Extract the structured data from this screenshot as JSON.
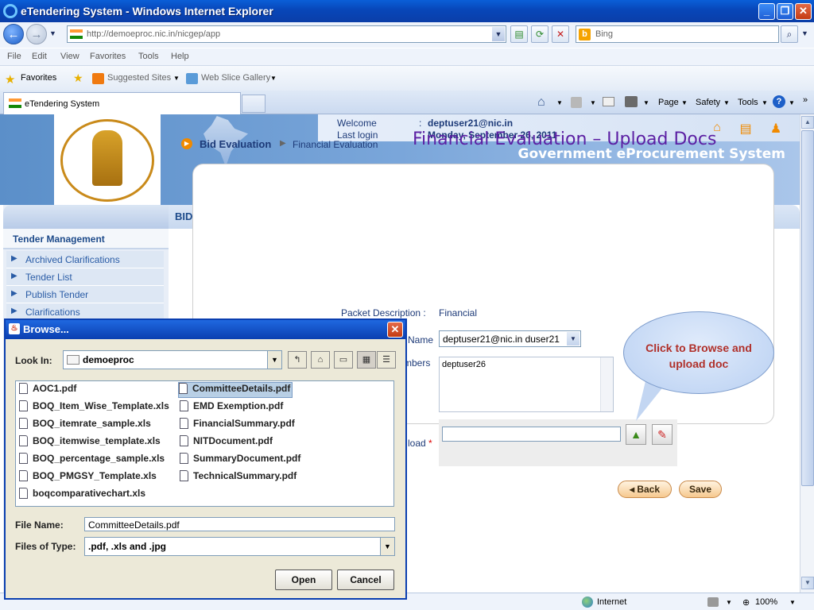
{
  "window": {
    "title": "eTendering System - Windows Internet Explorer",
    "address": "http://demoeproc.nic.in/nicgep/app",
    "search_placeholder": "Bing"
  },
  "menu": [
    "File",
    "Edit",
    "View",
    "Favorites",
    "Tools",
    "Help"
  ],
  "favorites": {
    "label": "Favorites",
    "suggested": "Suggested Sites",
    "webslice": "Web Slice Gallery"
  },
  "tab": {
    "title": "eTendering System"
  },
  "commandbar": {
    "page": "Page",
    "safety": "Safety",
    "tools": "Tools"
  },
  "header": {
    "welcome_label": "Welcome",
    "welcome_value": "deptuser21@nic.in",
    "lastlogin_label": "Last login",
    "lastlogin_value": "Monday, September 26, 2011",
    "separator": ":",
    "system_title": "Government eProcurement System",
    "emblem_text": "Government eProcurement System"
  },
  "sidebar": {
    "heading": "Tender Management",
    "items": [
      {
        "label": "Archived Clarifications"
      },
      {
        "label": "Tender List"
      },
      {
        "label": "Publish Tender"
      },
      {
        "label": "Clarifications"
      }
    ]
  },
  "main": {
    "section_title": "BID EVALUATION",
    "breadcrumb_1": "Bid Evaluation",
    "breadcrumb_2": "Financial Evaluation",
    "page_title": "Financial Evaluation – Upload Docs",
    "packet_label": "Packet Description :",
    "packet_value": "Financial",
    "name_label_fragment": "Name",
    "name_select": "deptuser21@nic.in duser21",
    "members_label_fragment": "mbers",
    "members_value": "deptuser26",
    "upload_label_fragment": "load",
    "back_label": "Back",
    "save_label": "Save",
    "callout": "Click to Browse and upload doc"
  },
  "statusbar": {
    "zone": "Internet",
    "zoom": "100%"
  },
  "dialog": {
    "title": "Browse...",
    "look_in_label": "Look In:",
    "look_in_value": "demoeproc",
    "files_col1": [
      "AOC1.pdf",
      "BOQ_Item_Wise_Template.xls",
      "BOQ_itemrate_sample.xls",
      "BOQ_itemwise_template.xls",
      "BOQ_percentage_sample.xls",
      "BOQ_PMGSY_Template.xls",
      "boqcomparativechart.xls"
    ],
    "files_col2": [
      "CommitteeDetails.pdf",
      "EMD Exemption.pdf",
      "FinancialSummary.pdf",
      "NITDocument.pdf",
      "SummaryDocument.pdf",
      "TechnicalSummary.pdf"
    ],
    "selected_file": "CommitteeDetails.pdf",
    "file_name_label": "File Name:",
    "file_name_value": "CommitteeDetails.pdf",
    "file_type_label": "Files of Type:",
    "file_type_value": ".pdf, .xls and .jpg",
    "open_label": "Open",
    "cancel_label": "Cancel"
  }
}
